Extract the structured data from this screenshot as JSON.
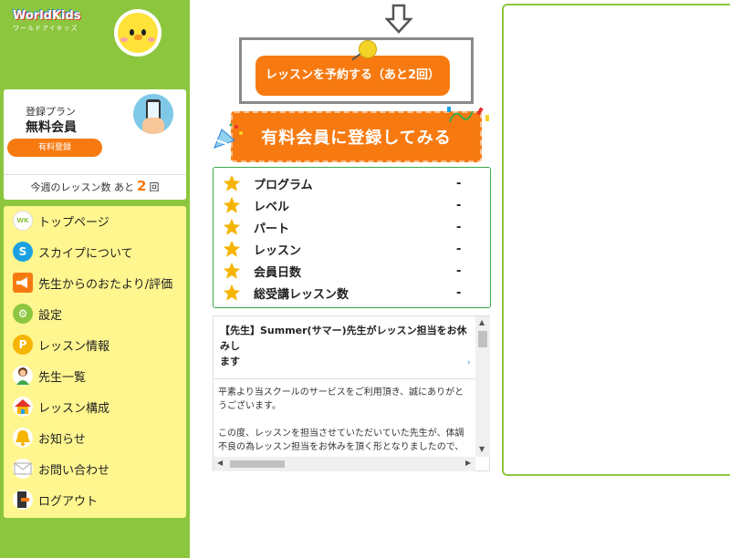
{
  "sidebar": {
    "logo_text": "WorldKids",
    "logo_sub": "ワールドアイキッズ",
    "plan": {
      "label": "登録プラン",
      "name": "無料会員",
      "button": "有料登録"
    },
    "lessons_remaining": {
      "prefix": "今週のレッスン数 あと",
      "count": "2",
      "suffix": "回"
    },
    "menu": [
      {
        "label": "トップページ",
        "icon": "worldkids-icon"
      },
      {
        "label": "スカイプについて",
        "icon": "skype-icon"
      },
      {
        "label": "先生からのおたより/評価",
        "icon": "megaphone-icon"
      },
      {
        "label": "設定",
        "icon": "gear-icon"
      },
      {
        "label": "レッスン情報",
        "icon": "coin-icon"
      },
      {
        "label": "先生一覧",
        "icon": "teacher-icon"
      },
      {
        "label": "レッスン構成",
        "icon": "house-icon"
      },
      {
        "label": "お知らせ",
        "icon": "bell-icon"
      },
      {
        "label": "お問い合わせ",
        "icon": "envelope-icon"
      },
      {
        "label": "ログアウト",
        "icon": "logout-icon"
      }
    ]
  },
  "main": {
    "reserve_button": "レッスンを予約する（あと2回）",
    "paid_banner": "有料会員に登録してみる",
    "stats": [
      {
        "label": "プログラム",
        "value": "-"
      },
      {
        "label": "レベル",
        "value": "-"
      },
      {
        "label": "パート",
        "value": "-"
      },
      {
        "label": "レッスン",
        "value": "-"
      },
      {
        "label": "会員日数",
        "value": "-"
      },
      {
        "label": "総受講レッスン数",
        "value": "-"
      }
    ],
    "notice": {
      "title_line1": "【先生】Summer(サマー)先生がレッスン担当をお休みし",
      "title_line2": "ます",
      "body_p1_l1": "平素より当スクールのサービスをご利用頂き、誠にありがと",
      "body_p1_l2": "うございます。",
      "body_p2_l1": "この度、レッスンを担当させていただいていた先生が、体調",
      "body_p2_l2": "不良の為レッスン担当をお休みを頂く形となりましたので、"
    }
  },
  "colors": {
    "sidebar_green": "#8cc63f",
    "accent_orange": "#f77a11",
    "menu_yellow": "#fff68f",
    "stats_border": "#3aa84a"
  }
}
